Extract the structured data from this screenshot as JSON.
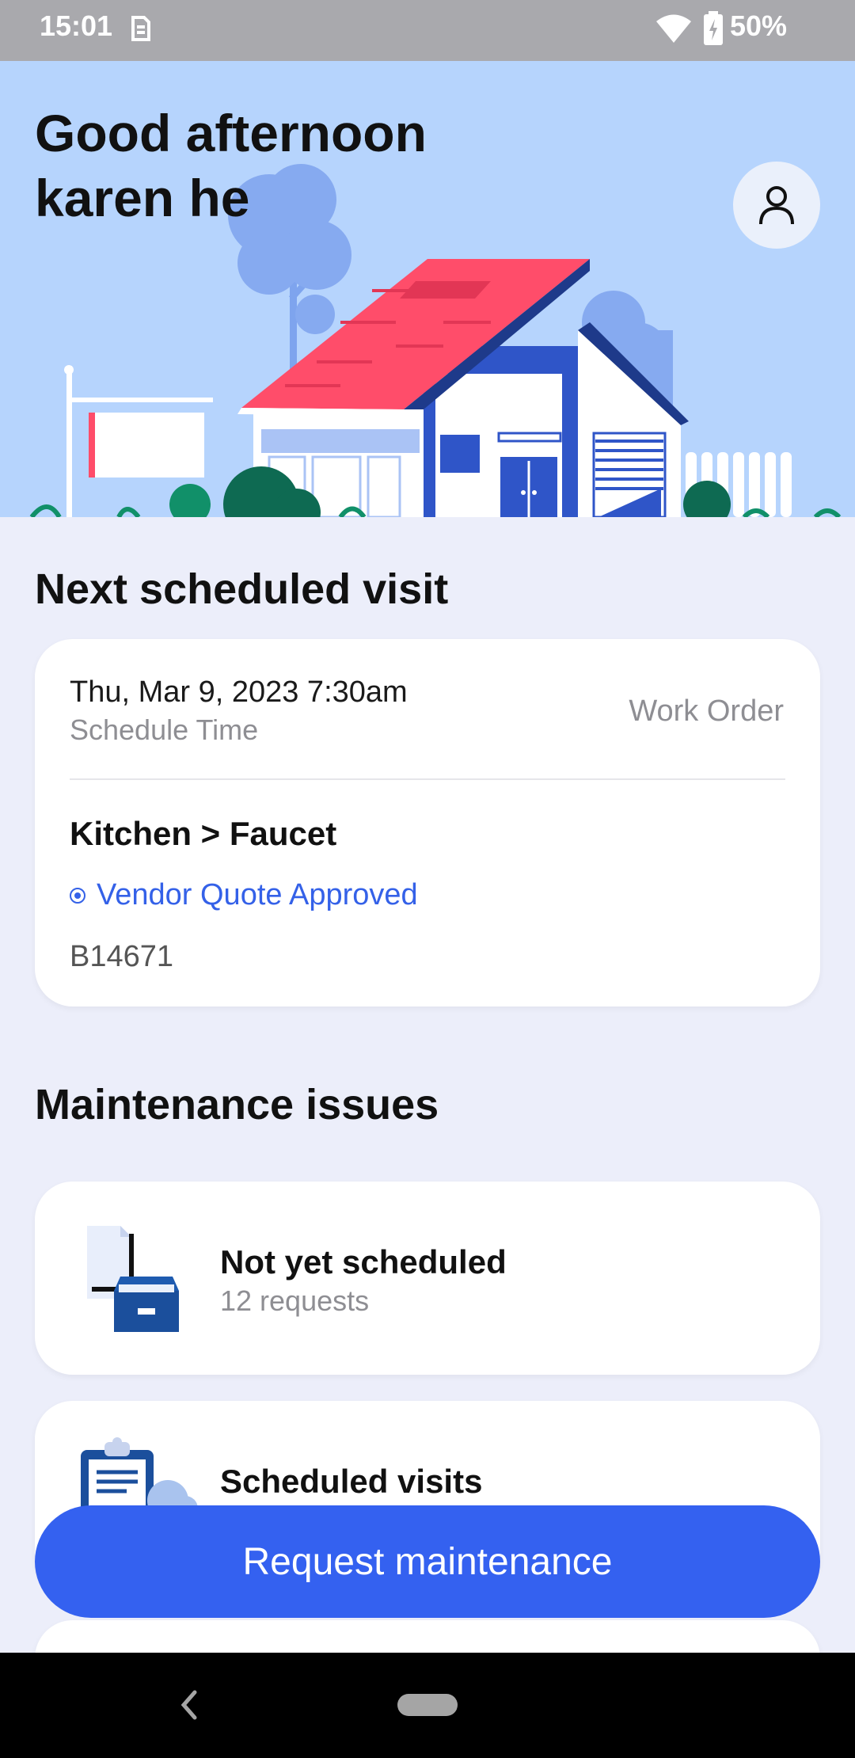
{
  "status_bar": {
    "time": "15:01",
    "battery": "50%"
  },
  "header": {
    "greeting_line1": "Good afternoon",
    "greeting_line2": "karen he"
  },
  "next_visit": {
    "section_title": "Next scheduled visit",
    "datetime": "Thu, Mar 9, 2023 7:30am",
    "datetime_label": "Schedule Time",
    "type": "Work Order",
    "location": "Kitchen > Faucet",
    "status": "Vendor Quote Approved",
    "code": "B14671"
  },
  "maintenance": {
    "section_title": "Maintenance issues",
    "items": [
      {
        "title": "Not yet scheduled",
        "subtitle": "12 requests",
        "icon": "file-cabinet-icon"
      },
      {
        "title": "Scheduled visits",
        "subtitle": "",
        "icon": "clipboard-icon"
      }
    ]
  },
  "actions": {
    "request_label": "Request maintenance"
  },
  "colors": {
    "accent": "#3461f0",
    "hero_bg": "#b6d4fd",
    "roof": "#ff4d6a",
    "page_bg": "#eceefa"
  }
}
